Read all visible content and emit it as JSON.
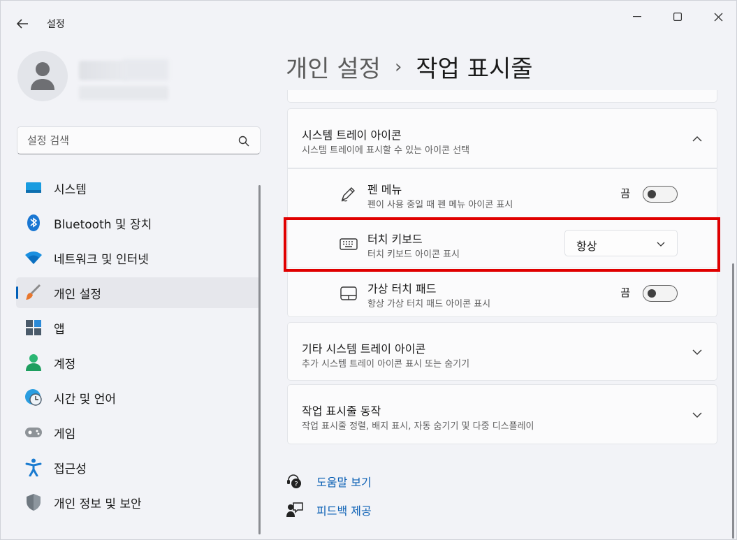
{
  "window": {
    "title": "설정"
  },
  "search": {
    "placeholder": "설정 검색"
  },
  "sidebar": {
    "items": [
      {
        "label": "시스템",
        "icon": "monitor-icon"
      },
      {
        "label": "Bluetooth 및 장치",
        "icon": "bluetooth-icon"
      },
      {
        "label": "네트워크 및 인터넷",
        "icon": "wifi-icon"
      },
      {
        "label": "개인 설정",
        "icon": "paintbrush-icon",
        "active": true
      },
      {
        "label": "앱",
        "icon": "apps-icon"
      },
      {
        "label": "계정",
        "icon": "account-icon"
      },
      {
        "label": "시간 및 언어",
        "icon": "globe-clock-icon"
      },
      {
        "label": "게임",
        "icon": "gamepad-icon"
      },
      {
        "label": "접근성",
        "icon": "accessibility-icon"
      },
      {
        "label": "개인 정보 및 보안",
        "icon": "shield-icon"
      }
    ]
  },
  "breadcrumb": {
    "parent": "개인 설정",
    "separator": "›",
    "current": "작업 표시줄"
  },
  "tray_icons": {
    "title": "시스템 트레이 아이콘",
    "subtitle": "시스템 트레이에 표시할 수 있는 아이콘 선택",
    "rows": [
      {
        "title": "펜 메뉴",
        "subtitle": "펜이 사용 중일 때 펜 메뉴 아이콘 표시",
        "state_label": "끔"
      },
      {
        "title": "터치 키보드",
        "subtitle": "터치 키보드 아이콘 표시",
        "dropdown_value": "항상"
      },
      {
        "title": "가상 터치 패드",
        "subtitle": "항상 가상 터치 패드 아이콘 표시",
        "state_label": "끔"
      }
    ]
  },
  "other_tray": {
    "title": "기타 시스템 트레이 아이콘",
    "subtitle": "추가 시스템 트레이 아이콘 표시 또는 숨기기"
  },
  "behaviors": {
    "title": "작업 표시줄 동작",
    "subtitle": "작업 표시줄 정렬, 배지 표시, 자동 숨기기 및 다중 디스플레이"
  },
  "links": {
    "help": "도움말 보기",
    "feedback": "피드백 제공"
  },
  "colors": {
    "accent": "#005fb8",
    "highlight": "#e00000",
    "link": "#0a5fb4"
  }
}
